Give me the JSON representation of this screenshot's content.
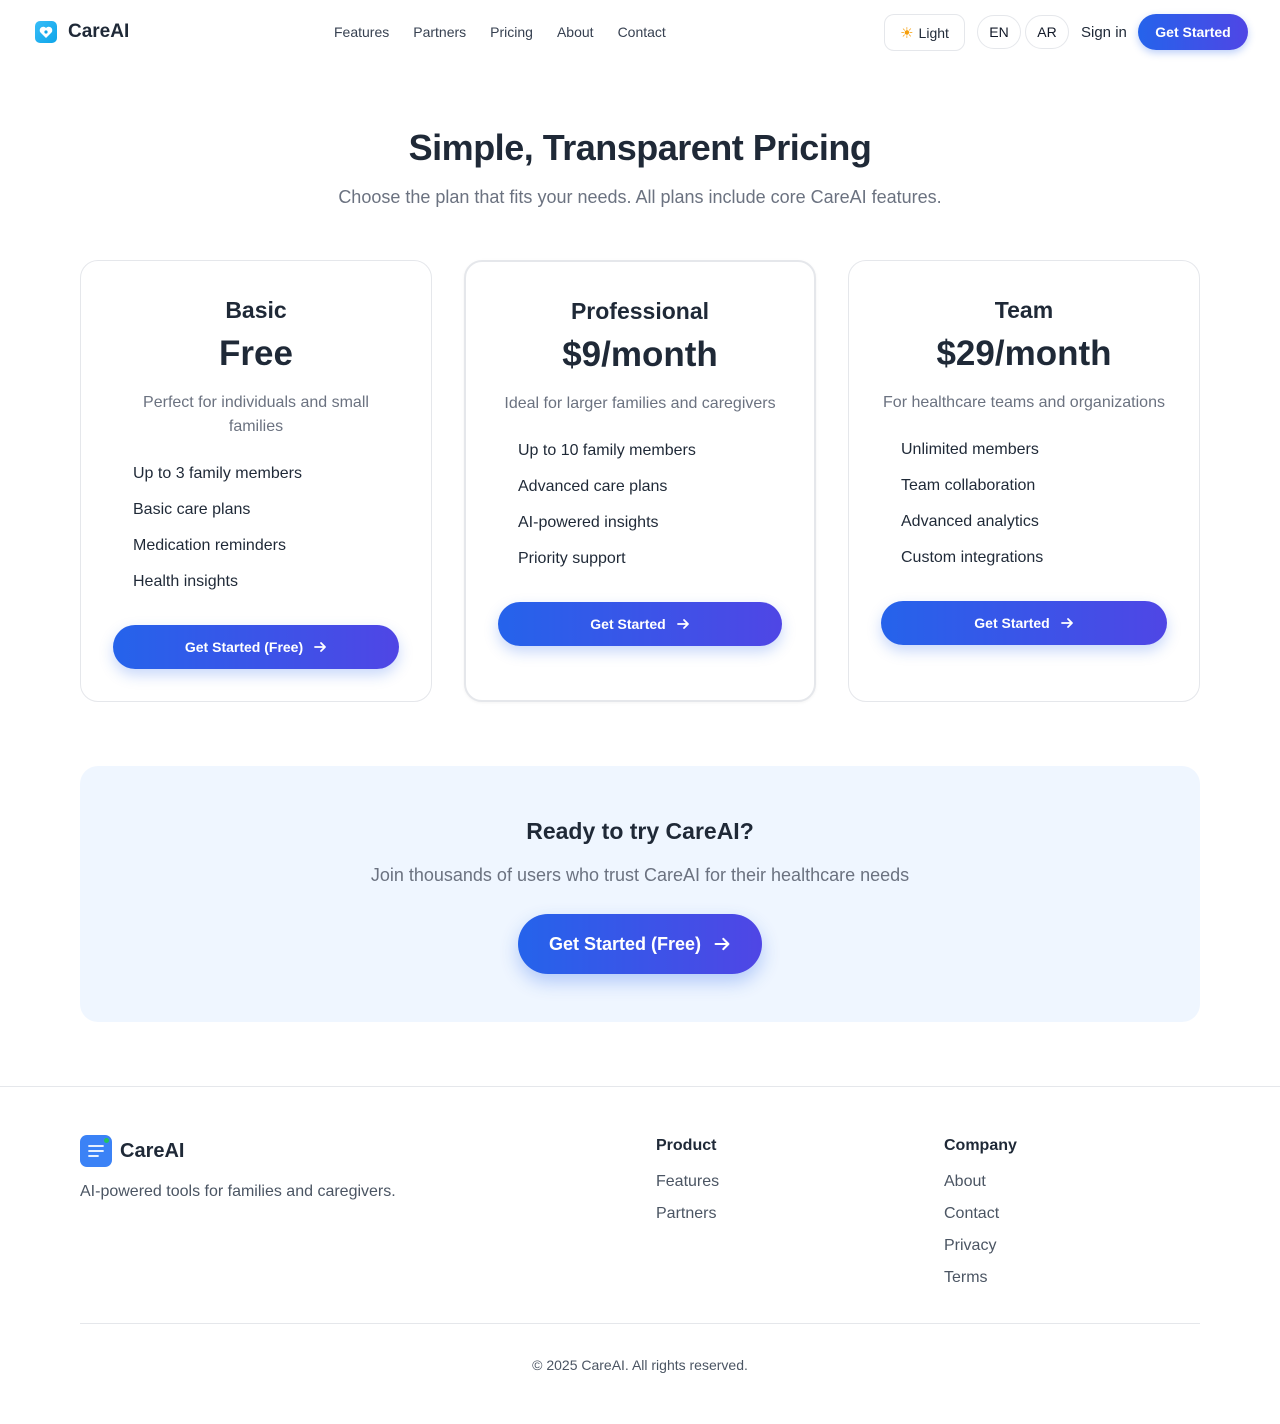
{
  "nav": {
    "brand": "CareAI",
    "links": [
      "Features",
      "Partners",
      "Pricing",
      "About",
      "Contact"
    ],
    "theme_label": "Light",
    "lang_en": "EN",
    "lang_ar": "AR",
    "signin": "Sign in",
    "cta": "Get Started"
  },
  "hero": {
    "title": "Simple, Transparent Pricing",
    "subtitle": "Choose the plan that fits your needs. All plans include core CareAI features."
  },
  "plans": [
    {
      "name": "Basic",
      "price": "Free",
      "description": "Perfect for individuals and small families",
      "features": [
        "Up to 3 family members",
        "Basic care plans",
        "Medication reminders",
        "Health insights"
      ],
      "cta": "Get Started (Free)"
    },
    {
      "name": "Professional",
      "price": "$9/month",
      "description": "Ideal for larger families and caregivers",
      "features": [
        "Up to 10 family members",
        "Advanced care plans",
        "AI-powered insights",
        "Priority support"
      ],
      "cta": "Get Started"
    },
    {
      "name": "Team",
      "price": "$29/month",
      "description": "For healthcare teams and organizations",
      "features": [
        "Unlimited members",
        "Team collaboration",
        "Advanced analytics",
        "Custom integrations"
      ],
      "cta": "Get Started"
    }
  ],
  "cta_band": {
    "title": "Ready to try CareAI?",
    "subtitle": "Join thousands of users who trust CareAI for their healthcare needs",
    "button": "Get Started (Free)"
  },
  "footer": {
    "brand": "CareAI",
    "tagline": "AI-powered tools for families and caregivers.",
    "product_title": "Product",
    "product_links": [
      "Features",
      "Partners"
    ],
    "company_title": "Company",
    "company_links": [
      "About",
      "Contact",
      "Privacy",
      "Terms"
    ],
    "copyright": "© 2025 CareAI. All rights reserved."
  },
  "colors": {
    "accent_start": "#2563eb",
    "accent_end": "#4f46e5",
    "band_bg": "#eff6ff",
    "text_dark": "#1f2937",
    "text_muted": "#6b7280"
  }
}
